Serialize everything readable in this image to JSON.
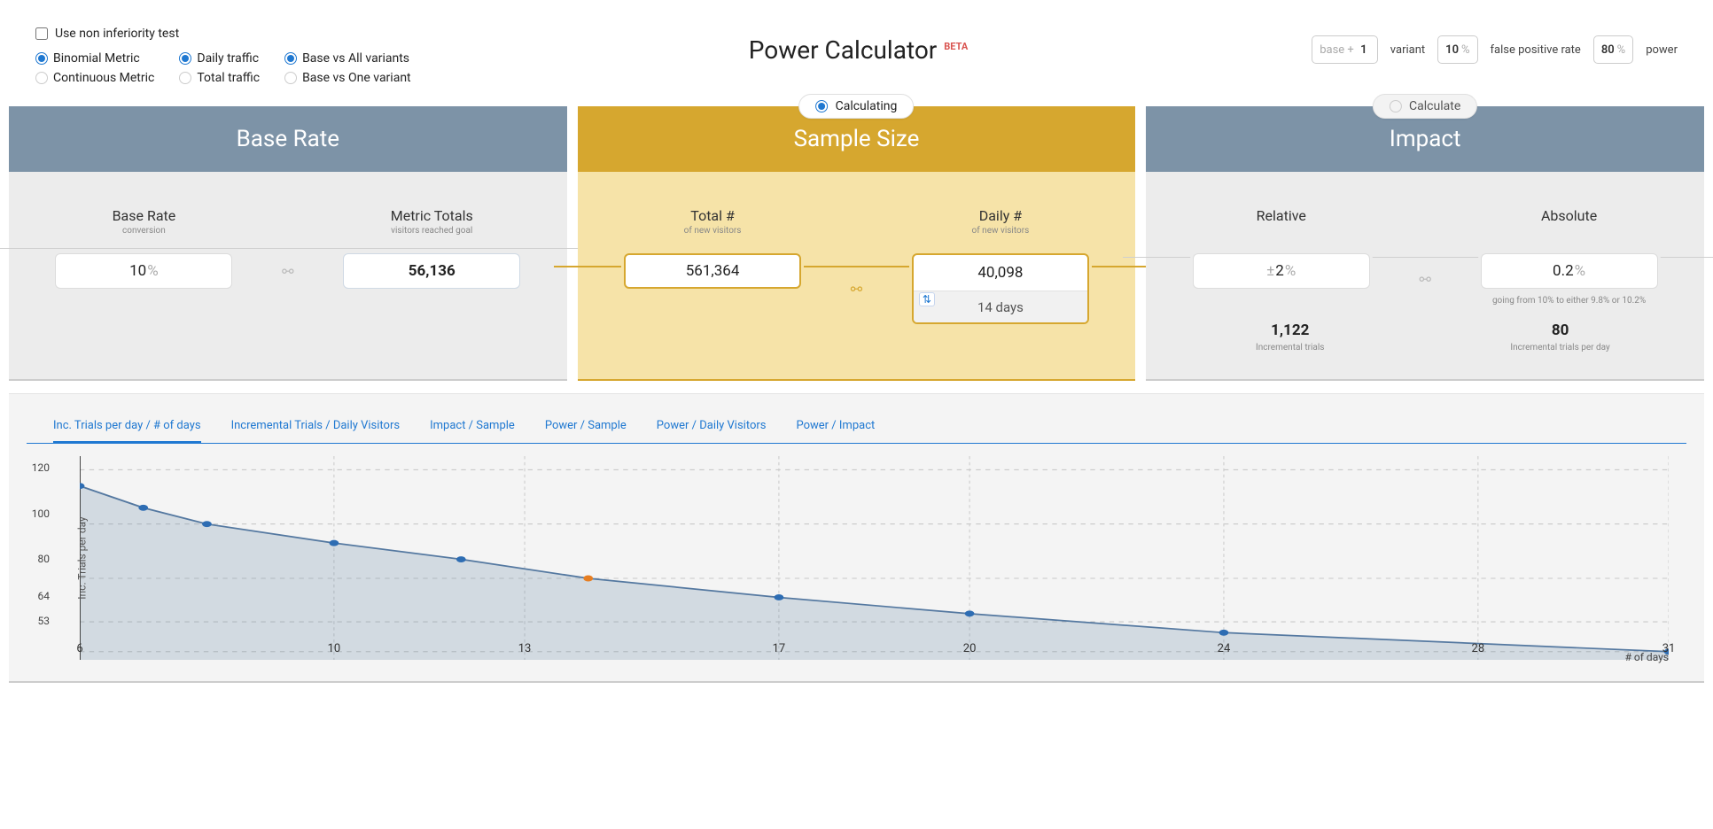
{
  "header": {
    "title": "Power Calculator",
    "beta": "BETA"
  },
  "checkbox": {
    "label": "Use non inferiority test",
    "checked": false
  },
  "radios": {
    "metric": {
      "opt1": "Binomial Metric",
      "opt2": "Continuous Metric",
      "selected": "opt1"
    },
    "traffic": {
      "opt1": "Daily traffic",
      "opt2": "Total traffic",
      "selected": "opt1"
    },
    "compare": {
      "opt1": "Base vs All variants",
      "opt2": "Base vs One variant",
      "selected": "opt1"
    }
  },
  "settings": {
    "variant": {
      "prefix": "base +",
      "value": "1",
      "label": "variant"
    },
    "fpr": {
      "value": "10",
      "label": "false positive rate"
    },
    "power": {
      "value": "80",
      "label": "power"
    }
  },
  "columns": {
    "base_rate": {
      "title": "Base Rate",
      "rate": {
        "title": "Base Rate",
        "sub": "conversion",
        "value": "10"
      },
      "totals": {
        "title": "Metric Totals",
        "sub": "visitors reached goal",
        "value": "56,136"
      }
    },
    "sample_size": {
      "title": "Sample Size",
      "pill": "Calculating",
      "total": {
        "title": "Total #",
        "sub": "of new visitors",
        "value": "561,364"
      },
      "daily": {
        "title": "Daily #",
        "sub": "of new visitors",
        "value": "40,098",
        "days": "14 days"
      }
    },
    "impact": {
      "title": "Impact",
      "pill": "Calculate",
      "relative": {
        "title": "Relative",
        "value": "2"
      },
      "absolute": {
        "title": "Absolute",
        "value": "0.2",
        "note": "going from 10% to either 9.8% or 10.2%"
      },
      "inc_trials": {
        "value": "1,122",
        "label": "Incremental trials"
      },
      "inc_trials_per_day": {
        "value": "80",
        "label": "Incremental trials per day"
      }
    }
  },
  "chart_tabs": [
    "Inc. Trials per day / # of days",
    "Incremental Trials / Daily Visitors",
    "Impact / Sample",
    "Power / Sample",
    "Power / Daily Visitors",
    "Power / Impact"
  ],
  "chart": {
    "y_label": "Inc. Trials per day",
    "x_label": "# of days",
    "y_ticks": [
      "120",
      "100",
      "80",
      "64",
      "53"
    ],
    "x_ticks": [
      "6",
      "10",
      "13",
      "17",
      "20",
      "24",
      "28",
      "31"
    ]
  },
  "chart_data": {
    "type": "line",
    "title": "Inc. Trials per day / # of days",
    "xlabel": "# of days",
    "ylabel": "Inc. Trials per day",
    "xlim": [
      6,
      31
    ],
    "ylim": [
      50,
      125
    ],
    "highlight_x": 14,
    "series": [
      {
        "name": "Inc. Trials per day",
        "x": [
          6,
          7,
          8,
          10,
          12,
          14,
          17,
          20,
          24,
          31
        ],
        "y": [
          114,
          106,
          100,
          93,
          87,
          80,
          73,
          67,
          60,
          53
        ]
      }
    ]
  }
}
